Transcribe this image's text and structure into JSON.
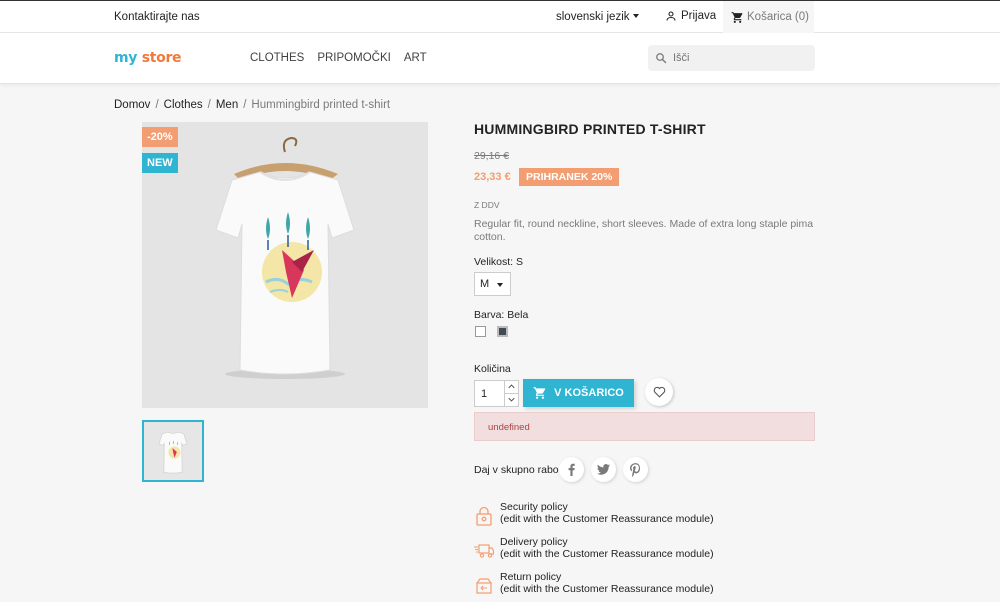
{
  "topbar": {
    "contact": "Kontaktirajte nas",
    "language": "slovenski jezik",
    "login": "Prijava",
    "cart": "Košarica (0)"
  },
  "header": {
    "logo_part1": "my",
    "logo_part2": "store",
    "menu": [
      "CLOTHES",
      "PRIPOMOČKI",
      "ART"
    ],
    "search_placeholder": "Išči"
  },
  "breadcrumb": [
    "Domov",
    "Clothes",
    "Men",
    "Hummingbird printed t-shirt"
  ],
  "product": {
    "badge_discount": "-20%",
    "badge_new": "NEW",
    "title": "HUMMINGBIRD PRINTED T-SHIRT",
    "old_price": "29,16 €",
    "price": "23,33 €",
    "save_label": "PRIHRANEK 20%",
    "tax": "Z DDV",
    "description": "Regular fit, round neckline, short sleeves. Made of extra long staple pima cotton.",
    "size_label": "Velikost: S",
    "size_value": "M",
    "color_label": "Barva: Bela",
    "colors": [
      "#ffffff",
      "#434a54"
    ],
    "quantity_label": "Količina",
    "quantity_value": "1",
    "add_to_cart": "V KOŠARICO",
    "alert": "undefined",
    "share_label": "Daj v skupno rabo"
  },
  "reassurance": [
    {
      "title": "Security policy",
      "sub": "(edit with the Customer Reassurance module)"
    },
    {
      "title": "Delivery policy",
      "sub": "(edit with the Customer Reassurance module)"
    },
    {
      "title": "Return policy",
      "sub": "(edit with the Customer Reassurance module)"
    }
  ],
  "colors": {
    "accent": "#2fb5d2",
    "discount": "#f39d72",
    "alert_bg": "#f2dede"
  }
}
